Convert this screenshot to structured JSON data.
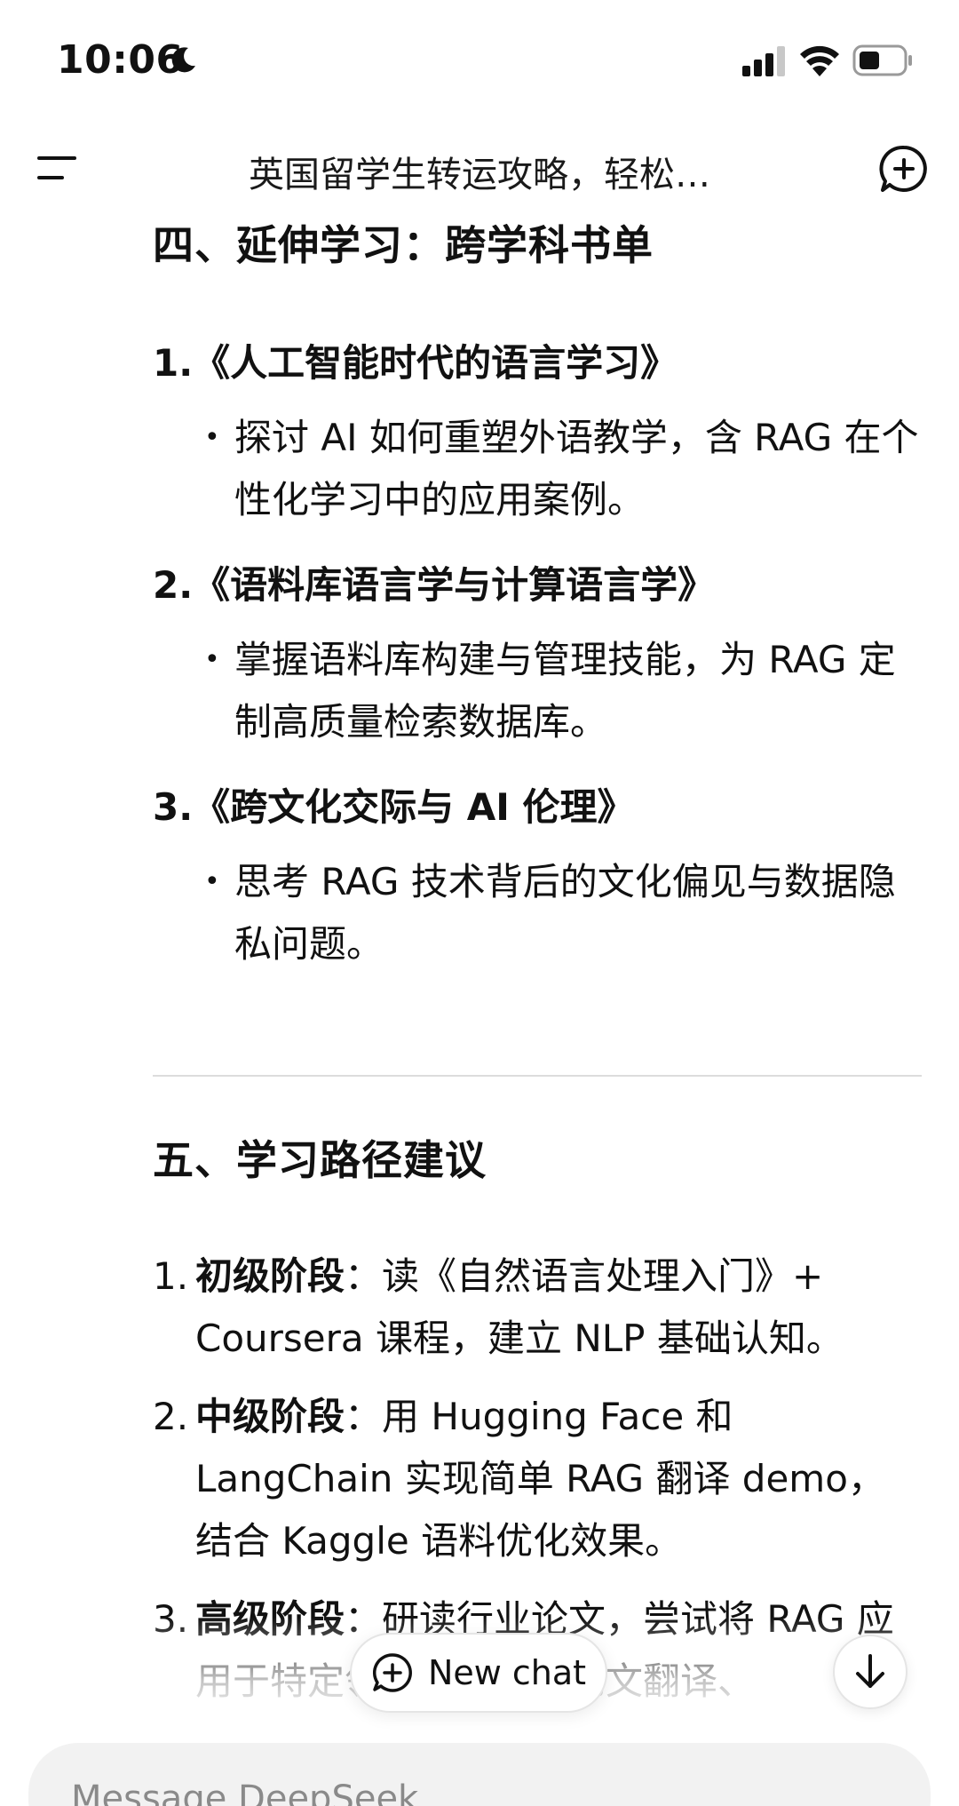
{
  "status": {
    "time": "10:06"
  },
  "header": {
    "title": "英国留学生转运攻略，轻松…"
  },
  "section4": {
    "title": "四、延伸学习：跨学科书单",
    "books": [
      {
        "title": "1.《人工智能时代的语言学习》",
        "desc": "探讨 AI 如何重塑外语教学，含 RAG 在个性化学习中的应用案例。"
      },
      {
        "title": "2.《语料库语言学与计算语言学》",
        "desc": "掌握语料库构建与管理技能，为 RAG 定制高质量检索数据库。"
      },
      {
        "title": "3.《跨文化交际与 AI 伦理》",
        "desc": "思考 RAG 技术背后的文化偏见与数据隐私问题。"
      }
    ]
  },
  "section5": {
    "title": "五、学习路径建议",
    "steps": [
      {
        "num": "1.",
        "label": "初级阶段",
        "text": "：读《自然语言处理入门》+ Coursera 课程，建立 NLP 基础认知。"
      },
      {
        "num": "2.",
        "label": "中级阶段",
        "text": "：用 Hugging Face 和 LangChain 实现简单 RAG 翻译 demo，结合 Kaggle 语料优化效果。"
      },
      {
        "num": "3.",
        "label": "高级阶段",
        "text": "：研读行业论文，尝试将 RAG 应用于特定领域（如学术论文翻译、"
      }
    ]
  },
  "actions": {
    "new_chat": "New chat"
  },
  "composer": {
    "placeholder": "Message DeepSeek"
  },
  "icons": {
    "moon": "moon-icon",
    "signal": "signal-icon",
    "wifi": "wifi-icon",
    "battery": "battery-icon",
    "menu": "menu-icon",
    "compose": "new-chat-compose-icon",
    "plus_circle": "plus-circle-icon",
    "arrow_down": "arrow-down-icon"
  }
}
